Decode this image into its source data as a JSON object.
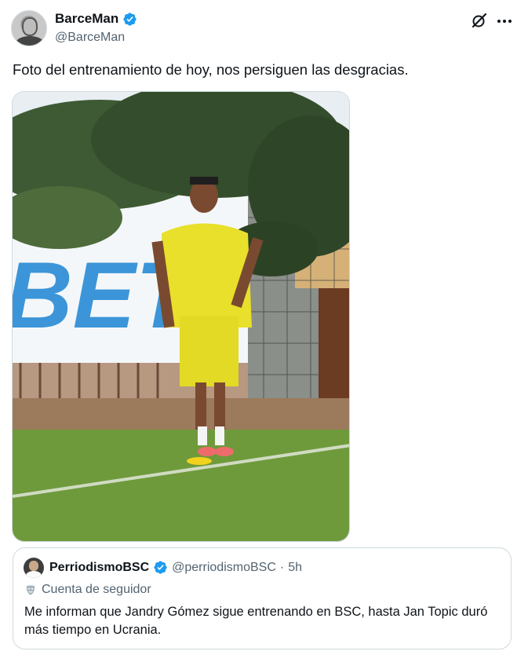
{
  "tweet": {
    "display_name": "BarceMan",
    "handle": "@BarceMan",
    "text": "Foto del entrenamiento de hoy, nos persiguen las desgracias.",
    "icons": {
      "verified": "verified-badge-icon",
      "grok": "grok-icon",
      "more": "more-options-icon"
    },
    "colors": {
      "verified": "#1d9bf0",
      "secondary_text": "#536471"
    }
  },
  "quote": {
    "display_name": "PerriodismoBSC",
    "handle": "@perriodismoBSC",
    "separator": "·",
    "time": "5h",
    "label": "Cuenta de seguidor",
    "text": "Me informan que Jandry Gómez sigue entrenando en BSC, hasta Jan Topic duró más tiempo en Ucrania."
  }
}
